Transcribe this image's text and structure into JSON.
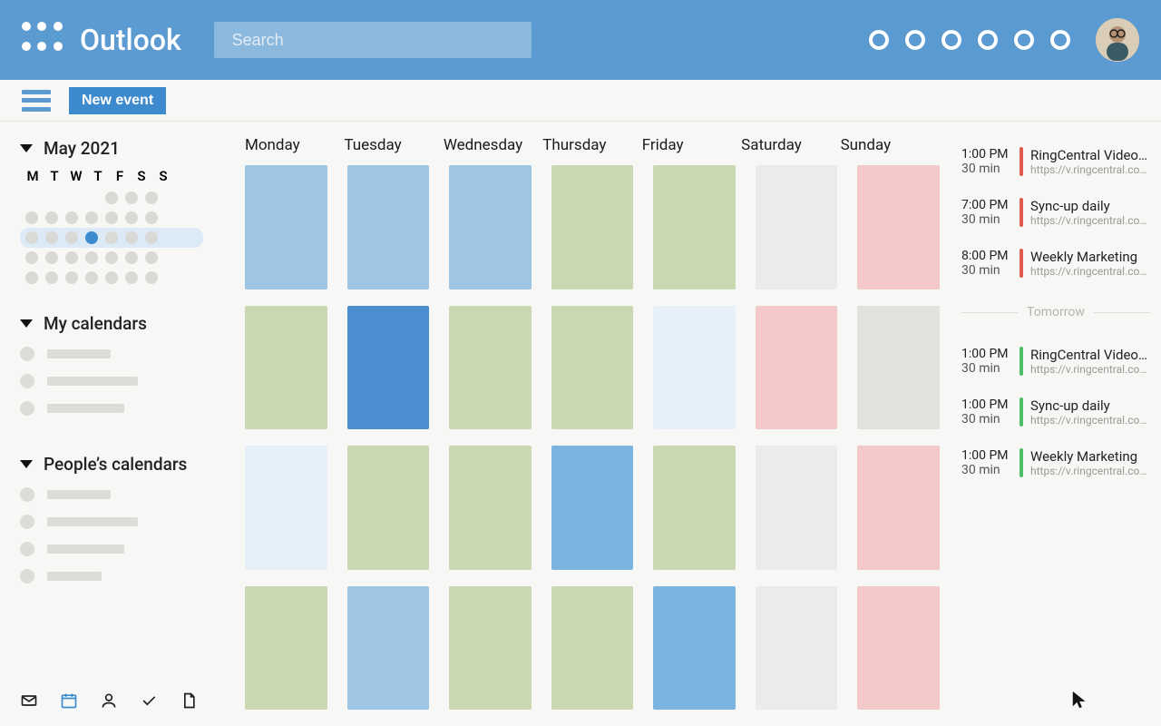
{
  "header": {
    "app_title": "Outlook",
    "search_placeholder": "Search"
  },
  "toolbar": {
    "new_event_label": "New event"
  },
  "sidebar": {
    "month_label": "May 2021",
    "mini_dow": [
      "M",
      "T",
      "W",
      "T",
      "F",
      "S",
      "S"
    ],
    "my_calendars_label": "My calendars",
    "peoples_calendars_label": "People’s calendars"
  },
  "grid": {
    "days": [
      "Monday",
      "Tuesday",
      "Wednesday",
      "Thursday",
      "Friday",
      "Saturday",
      "Sunday"
    ],
    "cells": [
      [
        "blue1",
        "blue1",
        "blue1",
        "green",
        "green",
        "greylt",
        "pink"
      ],
      [
        "green",
        "blue2",
        "green",
        "green",
        "bluelt",
        "pink",
        "faint"
      ],
      [
        "bluelt",
        "green",
        "green",
        "bluedk",
        "green",
        "greylt",
        "pink"
      ],
      [
        "green",
        "blue1",
        "green",
        "green",
        "bluedk",
        "greylt",
        "pink"
      ]
    ]
  },
  "agenda": {
    "divider_label": "Tomorrow",
    "today": [
      {
        "time": "1:00 PM",
        "duration": "30 min",
        "title": "RingCentral Video…",
        "link": "https://v.ringcentral.com/jo…",
        "color": "bar-red"
      },
      {
        "time": "7:00 PM",
        "duration": "30 min",
        "title": "Sync-up daily",
        "link": "https://v.ringcentral.com/jo…",
        "color": "bar-red"
      },
      {
        "time": "8:00 PM",
        "duration": "30 min",
        "title": "Weekly Marketing",
        "link": "https://v.ringcentral.com/jo…",
        "color": "bar-red"
      }
    ],
    "tomorrow": [
      {
        "time": "1:00 PM",
        "duration": "30 min",
        "title": "RingCentral Video…",
        "link": "https://v.ringcentral.com/jo…",
        "color": "bar-green"
      },
      {
        "time": "1:00 PM",
        "duration": "30 min",
        "title": "Sync-up daily",
        "link": "https://v.ringcentral.com/jo…",
        "color": "bar-green"
      },
      {
        "time": "1:00 PM",
        "duration": "30 min",
        "title": "Weekly Marketing",
        "link": "https://v.ringcentral.com/jo…",
        "color": "bar-green"
      }
    ]
  }
}
